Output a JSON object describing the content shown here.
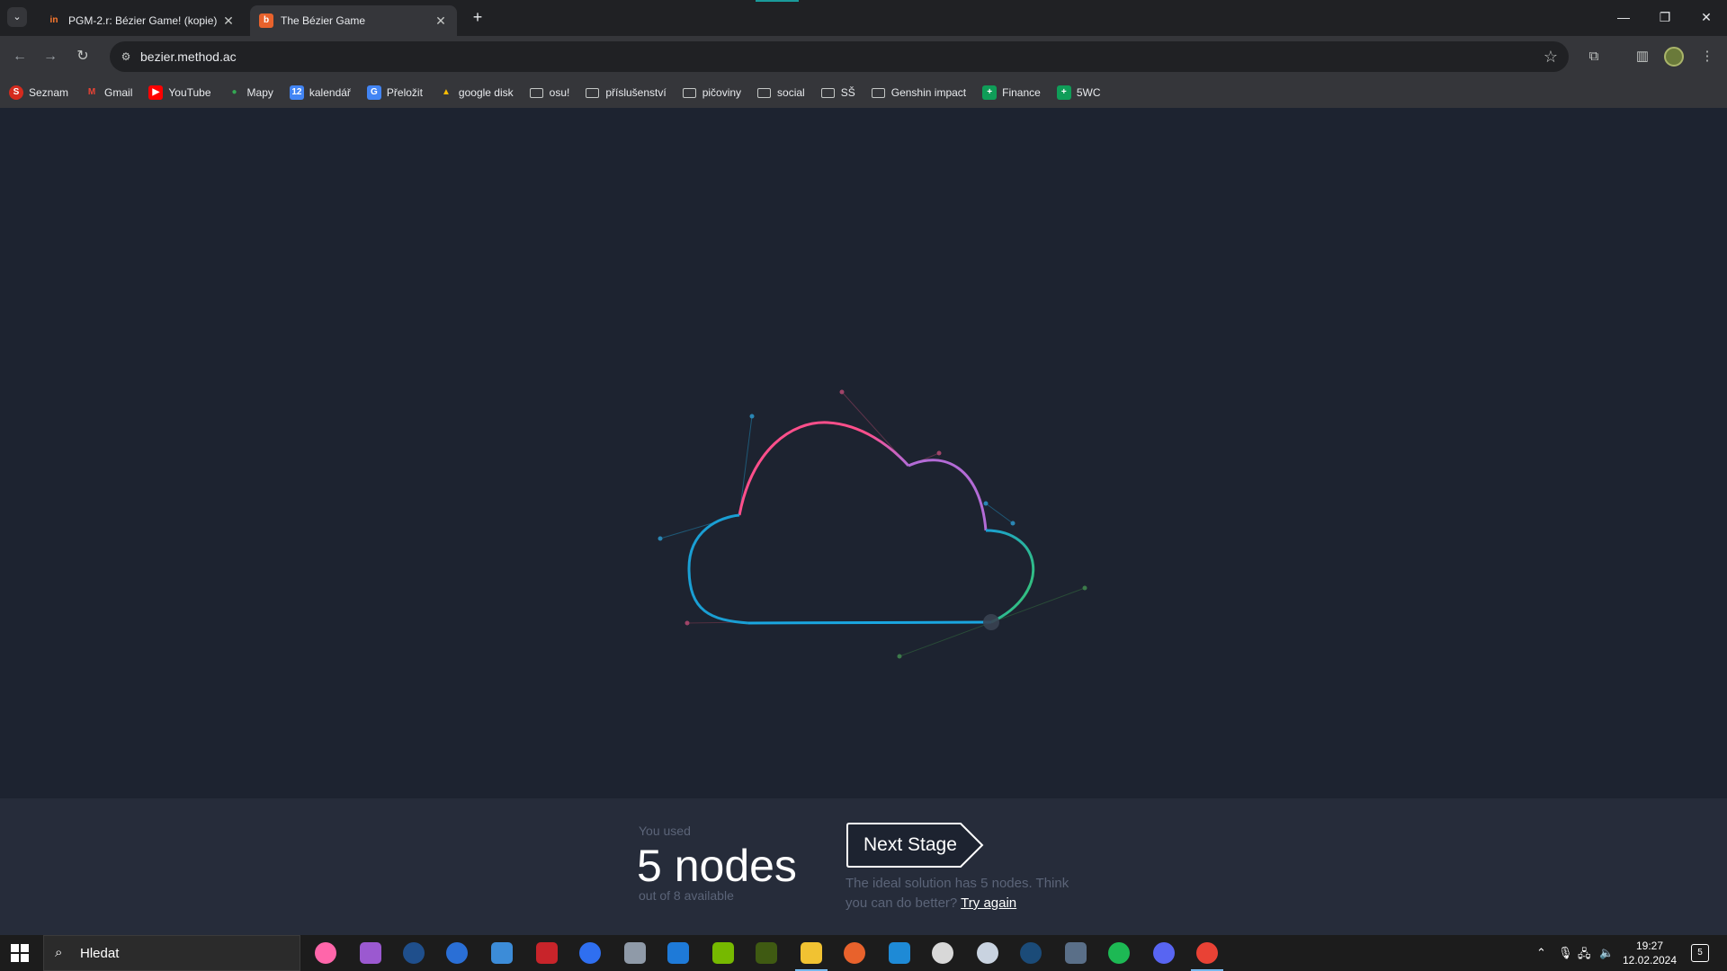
{
  "browser": {
    "tabs": [
      {
        "title": "PGM-2.r: Bézier Game! (kopie)",
        "favicon": "figma-favicon",
        "active": false
      },
      {
        "title": "The Bézier Game",
        "favicon": "bezier-game-favicon",
        "active": true
      }
    ],
    "url": "bezier.method.ac",
    "bookmarks": [
      {
        "label": "Seznam",
        "icon": "seznam-icon"
      },
      {
        "label": "Gmail",
        "icon": "gmail-icon"
      },
      {
        "label": "YouTube",
        "icon": "youtube-icon"
      },
      {
        "label": "Mapy",
        "icon": "maps-icon"
      },
      {
        "label": "kalendář",
        "icon": "calendar-icon"
      },
      {
        "label": "Přeložit",
        "icon": "translate-icon"
      },
      {
        "label": "google disk",
        "icon": "drive-icon"
      },
      {
        "label": "osu!",
        "icon": "folder-icon"
      },
      {
        "label": "příslušenství",
        "icon": "folder-icon"
      },
      {
        "label": "pičoviny",
        "icon": "folder-icon"
      },
      {
        "label": "social",
        "icon": "folder-icon"
      },
      {
        "label": "SŠ",
        "icon": "folder-icon"
      },
      {
        "label": "Genshin impact",
        "icon": "folder-icon"
      },
      {
        "label": "Finance",
        "icon": "sheets-icon"
      },
      {
        "label": "5WC",
        "icon": "sheets-icon"
      }
    ]
  },
  "game": {
    "shape": "cloud",
    "stroke_colors": [
      "#ff4f8b",
      "#b36bd6",
      "#1aa6e0",
      "#1a9fd4",
      "#39c86a"
    ],
    "result": {
      "used_label": "You used",
      "nodes_used": "5 nodes",
      "available": "out of 8 available",
      "next_stage_label": "Next Stage",
      "ideal_text": "The ideal solution has 5 nodes. Think you can do better?",
      "try_again_label": "Try again"
    }
  },
  "taskbar": {
    "search_placeholder": "Hledat",
    "time": "19:27",
    "date": "12.02.2024",
    "notification_count": "5"
  }
}
